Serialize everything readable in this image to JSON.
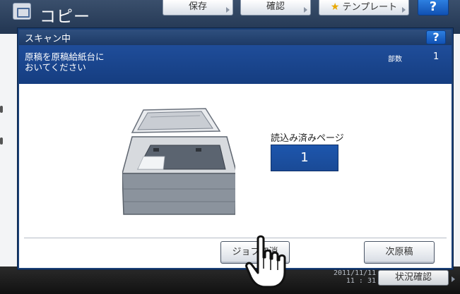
{
  "app": {
    "title": "コピー",
    "buttons": {
      "save": "保存",
      "confirm": "確認",
      "template": "テンプレート",
      "help": "?"
    }
  },
  "footer": {
    "date": "2011/11/11",
    "time": "11 : 31",
    "status_button": "状況確認"
  },
  "dialog": {
    "title": "スキャン中",
    "help": "?",
    "message": "原稿を原稿給紙台に\nおいてください",
    "copies_label": "部数",
    "copies_value": "1",
    "pages_label": "読込み済みページ",
    "pages_value": "1",
    "cancel_button": "ジョブ取消",
    "next_button": "次原稿"
  },
  "colors": {
    "header": "#223652",
    "dialog_titlebar": "#1d3a66",
    "message_band": "#1b4690",
    "counter_box": "#1d56ad",
    "help_button": "#1565c8"
  },
  "icons": [
    "app-copy-icon",
    "template-star-icon",
    "scanner-illustration",
    "hand-pointer-icon"
  ]
}
